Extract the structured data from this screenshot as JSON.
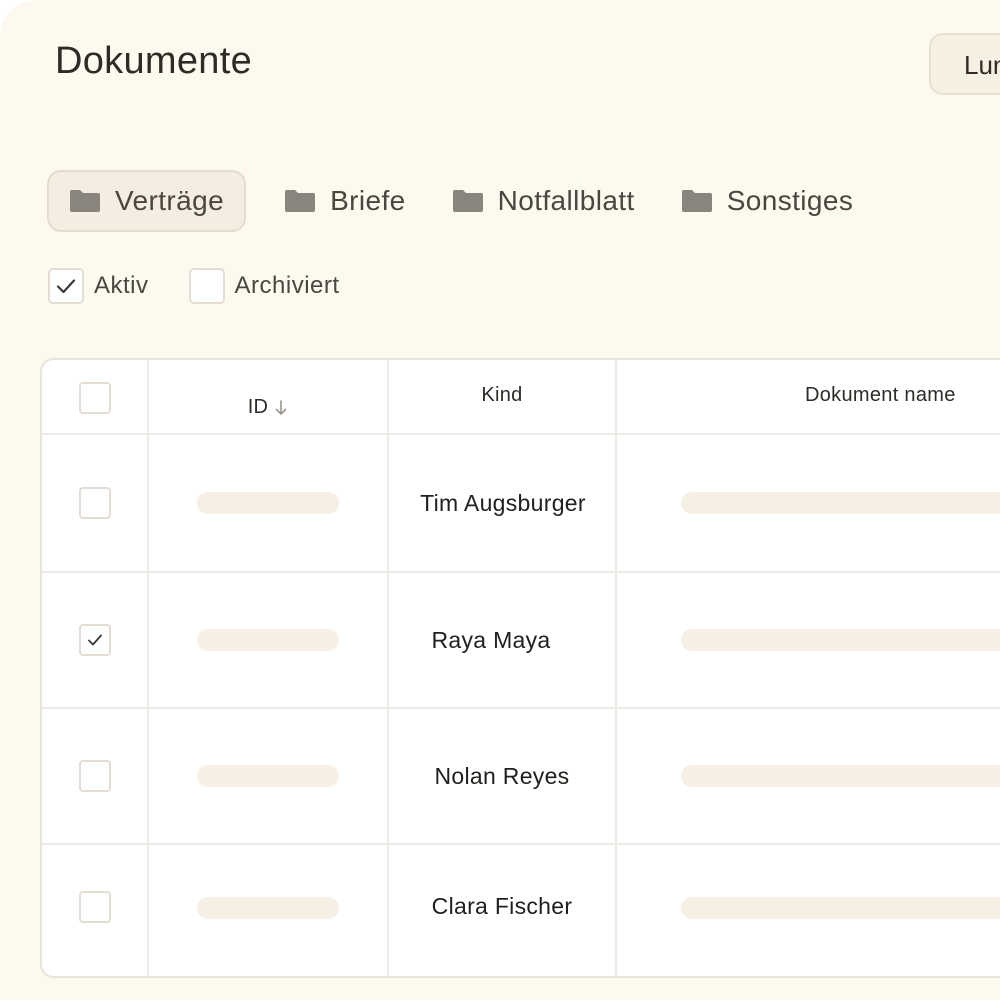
{
  "page": {
    "title": "Dokumente",
    "top_button_label": "Lun"
  },
  "tabs": [
    {
      "label": "Verträge",
      "icon": "folder-icon",
      "active": true
    },
    {
      "label": "Briefe",
      "icon": "folder-icon",
      "active": false
    },
    {
      "label": "Notfallblatt",
      "icon": "folder-icon",
      "active": false
    },
    {
      "label": "Sonstiges",
      "icon": "folder-icon",
      "active": false
    }
  ],
  "filters": [
    {
      "label": "Aktiv",
      "checked": true
    },
    {
      "label": "Archiviert",
      "checked": false
    }
  ],
  "table": {
    "columns": {
      "id": "ID",
      "id_sort_icon": "arrow-down-icon",
      "kind": "Kind",
      "name": "Dokument name"
    },
    "rows": [
      {
        "kind": "Tim Augsburger",
        "selected": false
      },
      {
        "kind": "Raya Maya",
        "selected": true
      },
      {
        "kind": "Nolan Reyes",
        "selected": false
      },
      {
        "kind": "Clara Fischer",
        "selected": false
      }
    ]
  },
  "colors": {
    "background": "#fef9ee",
    "active_tab": "#f5ede1",
    "skeleton": "#f6efe4",
    "folder_icon": "#8a857c"
  }
}
